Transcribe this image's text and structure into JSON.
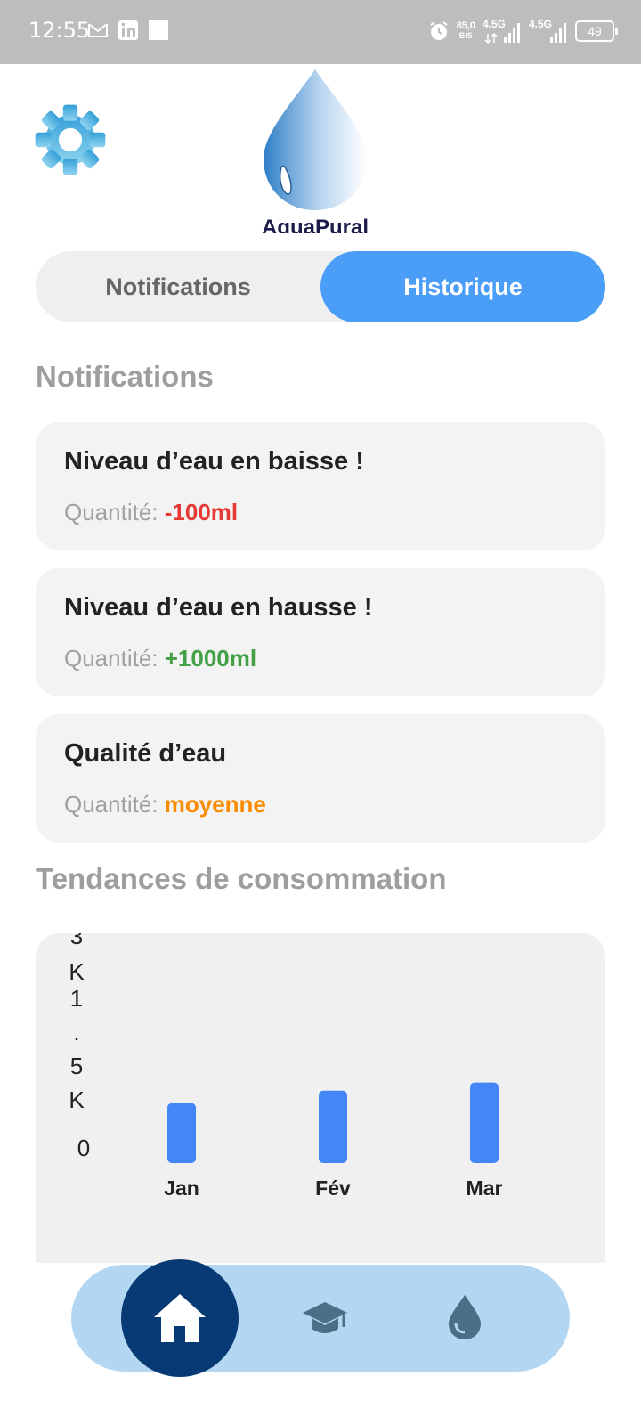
{
  "status_bar": {
    "time": "12:55",
    "net_speed_value": "85,0",
    "net_speed_unit": "B/S",
    "signal1_label": "4.5G",
    "signal2_label": "4.5G",
    "battery": "49"
  },
  "header": {
    "logo_text": "AquaPural"
  },
  "tabs": [
    {
      "label": "Notifications",
      "active": false
    },
    {
      "label": "Historique",
      "active": true
    }
  ],
  "notifications": {
    "title": "Notifications",
    "items": [
      {
        "title": "Niveau d’eau en baisse !",
        "prefix": "Quantité: ",
        "value": "-100ml",
        "color": "#e53935"
      },
      {
        "title": "Niveau d’eau en hausse !",
        "prefix": "Quantité: ",
        "value": "+1000ml",
        "color": "#43a047"
      },
      {
        "title": "Qualité d’eau",
        "prefix": "Quantité: ",
        "value": "moyenne",
        "color": "#fb8c00"
      }
    ]
  },
  "trends": {
    "title": "Tendances de consommation"
  },
  "chart_data": {
    "type": "bar",
    "categories": [
      "Jan",
      "Fév",
      "Mar"
    ],
    "values": [
      1100,
      1330,
      1480
    ],
    "ytick_labels": [
      "3K",
      "1.5K",
      "0"
    ],
    "ylim": [
      0,
      3000
    ],
    "bar_color": "#4287f5",
    "grid": false,
    "title": "",
    "xlabel": "",
    "ylabel": ""
  },
  "bottom_nav": {
    "items": [
      {
        "icon": "home-icon",
        "active": true
      },
      {
        "icon": "graduation-cap-icon",
        "active": false
      },
      {
        "icon": "water-drop-icon",
        "active": false
      }
    ],
    "active_color": "#073a74",
    "bar_color": "#b3d7f2"
  }
}
